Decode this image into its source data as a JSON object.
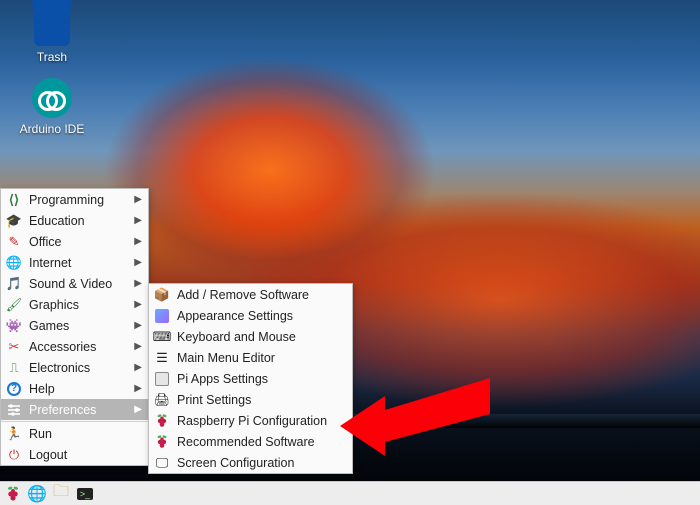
{
  "desktop": {
    "icons": [
      {
        "name": "trash",
        "label": "Trash"
      },
      {
        "name": "arduino-ide",
        "label": "Arduino IDE"
      }
    ]
  },
  "menu": {
    "main": [
      {
        "id": "programming",
        "label": "Programming",
        "submenu": true,
        "icon": "code-icon",
        "color": "#2e7d32"
      },
      {
        "id": "education",
        "label": "Education",
        "submenu": true,
        "icon": "grad-cap-icon",
        "color": "#b36b00"
      },
      {
        "id": "office",
        "label": "Office",
        "submenu": true,
        "icon": "bird-icon",
        "color": "#c62828"
      },
      {
        "id": "internet",
        "label": "Internet",
        "submenu": true,
        "icon": "globe-icon",
        "color": "#1565c0"
      },
      {
        "id": "sound-video",
        "label": "Sound & Video",
        "submenu": true,
        "icon": "media-icon",
        "color": "#ad1457"
      },
      {
        "id": "graphics",
        "label": "Graphics",
        "submenu": true,
        "icon": "palette-icon",
        "color": "#2e7d32"
      },
      {
        "id": "games",
        "label": "Games",
        "submenu": true,
        "icon": "alien-icon",
        "color": "#558b2f"
      },
      {
        "id": "accessories",
        "label": "Accessories",
        "submenu": true,
        "icon": "knife-icon",
        "color": "#d32f2f"
      },
      {
        "id": "electronics",
        "label": "Electronics",
        "submenu": true,
        "icon": "chip-icon",
        "color": "#2e7d32"
      },
      {
        "id": "help",
        "label": "Help",
        "submenu": true,
        "icon": "help-icon",
        "color": "#1976d2"
      },
      {
        "id": "preferences",
        "label": "Preferences",
        "submenu": true,
        "icon": "sliders-icon",
        "color": "#607d8b",
        "selected": true
      },
      {
        "id": "run",
        "label": "Run",
        "submenu": false,
        "icon": "run-icon",
        "color": "#2e7d32"
      },
      {
        "id": "logout",
        "label": "Logout",
        "submenu": false,
        "icon": "logout-icon",
        "color": "#d32f2f"
      }
    ],
    "separator_after_index": 10,
    "preferences_sub": [
      {
        "id": "add-remove",
        "label": "Add / Remove Software",
        "icon": "package-icon"
      },
      {
        "id": "appearance",
        "label": "Appearance Settings",
        "icon": "appearance-icon"
      },
      {
        "id": "kb-mouse",
        "label": "Keyboard and Mouse",
        "icon": "keyboard-mouse-icon"
      },
      {
        "id": "main-menu-ed",
        "label": "Main Menu Editor",
        "icon": "menu-editor-icon"
      },
      {
        "id": "pi-apps",
        "label": "Pi Apps Settings",
        "icon": "pi-apps-icon"
      },
      {
        "id": "print",
        "label": "Print Settings",
        "icon": "printer-icon"
      },
      {
        "id": "rpi-config",
        "label": "Raspberry Pi Configuration",
        "icon": "raspberry-icon",
        "highlighted": true
      },
      {
        "id": "recommended",
        "label": "Recommended Software",
        "icon": "raspberry-icon"
      },
      {
        "id": "screen-config",
        "label": "Screen Configuration",
        "icon": "monitor-icon"
      }
    ]
  },
  "taskbar": {
    "items": [
      {
        "id": "menu",
        "icon": "raspberry-icon"
      },
      {
        "id": "browser",
        "icon": "globe-icon"
      },
      {
        "id": "files",
        "icon": "folder-icon"
      },
      {
        "id": "terminal",
        "icon": "terminal-icon"
      }
    ]
  },
  "annotation": {
    "points_to": "rpi-config"
  }
}
